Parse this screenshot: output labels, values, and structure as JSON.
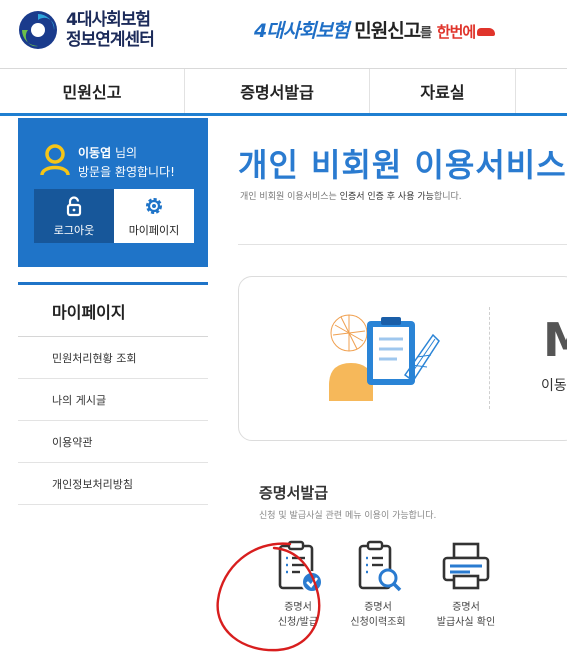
{
  "header": {
    "logo_line1": "4대사회보험",
    "logo_line2": "정보연계센터",
    "slogan_part1": "4대사회보험",
    "slogan_part2": "민원신고",
    "slogan_part3": "를",
    "slogan_part4": "한번에"
  },
  "nav": {
    "items": [
      "민원신고",
      "증명서발급",
      "자료실"
    ]
  },
  "user": {
    "name": "이동엽",
    "suffix": "님의",
    "welcome": "방문을 환영합니다!",
    "logout_label": "로그아웃",
    "mypage_label": "마이페이지"
  },
  "side": {
    "title": "마이페이지",
    "items": [
      "민원처리현황 조회",
      "나의 게시글",
      "이용약관",
      "개인정보처리방침"
    ]
  },
  "main": {
    "title": "개인 비회원 이용서비스",
    "subtitle_pre": "개인 비회원 이용서비스는 ",
    "subtitle_bold": "인증서 인증 후 사용 가능",
    "subtitle_post": "합니다.",
    "card_letter": "M",
    "card_text": "이동"
  },
  "section": {
    "title": "증명서발급",
    "subtitle": "신청 및 발급사실 관련 메뉴 이용이 가능합니다.",
    "services": [
      {
        "line1": "증명서",
        "line2": "신청/발급",
        "icon": "certificate-check-icon"
      },
      {
        "line1": "증명서",
        "line2": "신청이력조회",
        "icon": "certificate-search-icon"
      },
      {
        "line1": "증명서",
        "line2": "발급사실 확인",
        "icon": "printer-icon"
      }
    ]
  },
  "colors": {
    "primary": "#1f74c8",
    "accent": "#e0342b",
    "nav_border": "#1f7fd1"
  }
}
